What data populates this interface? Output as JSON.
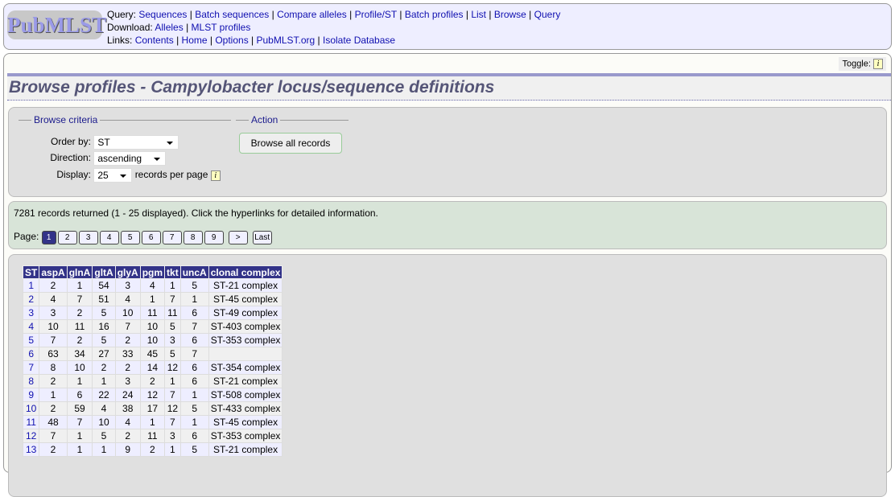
{
  "header": {
    "logo": "PubMLST",
    "query_label": "Query:",
    "query_links": [
      "Sequences",
      "Batch sequences",
      "Compare alleles",
      "Profile/ST",
      "Batch profiles",
      "List",
      "Browse",
      "Query"
    ],
    "download_label": "Download:",
    "download_links": [
      "Alleles",
      "MLST profiles"
    ],
    "links_label": "Links:",
    "links_links": [
      "Contents",
      "Home",
      "Options",
      "PubMLST.org",
      "Isolate Database"
    ]
  },
  "toggle_label": "Toggle:",
  "info_glyph": "i",
  "title": "Browse profiles - Campylobacter locus/sequence definitions",
  "criteria": {
    "legend": "Browse criteria",
    "order_label": "Order by:",
    "order_value": "ST",
    "direction_label": "Direction:",
    "direction_value": "ascending",
    "display_label": "Display:",
    "display_value": "25",
    "display_suffix": "records per page"
  },
  "action": {
    "legend": "Action",
    "button": "Browse all records"
  },
  "results": {
    "summary": "7281 records returned (1 - 25 displayed). Click the hyperlinks for detailed information.",
    "page_label": "Page:",
    "pages": [
      "1",
      "2",
      "3",
      "4",
      "5",
      "6",
      "7",
      "8",
      "9",
      ">",
      "Last"
    ]
  },
  "table": {
    "headers": [
      "ST",
      "aspA",
      "glnA",
      "gltA",
      "glyA",
      "pgm",
      "tkt",
      "uncA",
      "clonal complex"
    ],
    "rows": [
      [
        "1",
        "2",
        "1",
        "54",
        "3",
        "4",
        "1",
        "5",
        "ST-21 complex"
      ],
      [
        "2",
        "4",
        "7",
        "51",
        "4",
        "1",
        "7",
        "1",
        "ST-45 complex"
      ],
      [
        "3",
        "3",
        "2",
        "5",
        "10",
        "11",
        "11",
        "6",
        "ST-49 complex"
      ],
      [
        "4",
        "10",
        "11",
        "16",
        "7",
        "10",
        "5",
        "7",
        "ST-403 complex"
      ],
      [
        "5",
        "7",
        "2",
        "5",
        "2",
        "10",
        "3",
        "6",
        "ST-353 complex"
      ],
      [
        "6",
        "63",
        "34",
        "27",
        "33",
        "45",
        "5",
        "7",
        ""
      ],
      [
        "7",
        "8",
        "10",
        "2",
        "2",
        "14",
        "12",
        "6",
        "ST-354 complex"
      ],
      [
        "8",
        "2",
        "1",
        "1",
        "3",
        "2",
        "1",
        "6",
        "ST-21 complex"
      ],
      [
        "9",
        "1",
        "6",
        "22",
        "24",
        "12",
        "7",
        "1",
        "ST-508 complex"
      ],
      [
        "10",
        "2",
        "59",
        "4",
        "38",
        "17",
        "12",
        "5",
        "ST-433 complex"
      ],
      [
        "11",
        "48",
        "7",
        "10",
        "4",
        "1",
        "7",
        "1",
        "ST-45 complex"
      ],
      [
        "12",
        "7",
        "1",
        "5",
        "2",
        "11",
        "3",
        "6",
        "ST-353 complex"
      ],
      [
        "13",
        "2",
        "1",
        "1",
        "9",
        "2",
        "1",
        "5",
        "ST-21 complex"
      ]
    ]
  }
}
